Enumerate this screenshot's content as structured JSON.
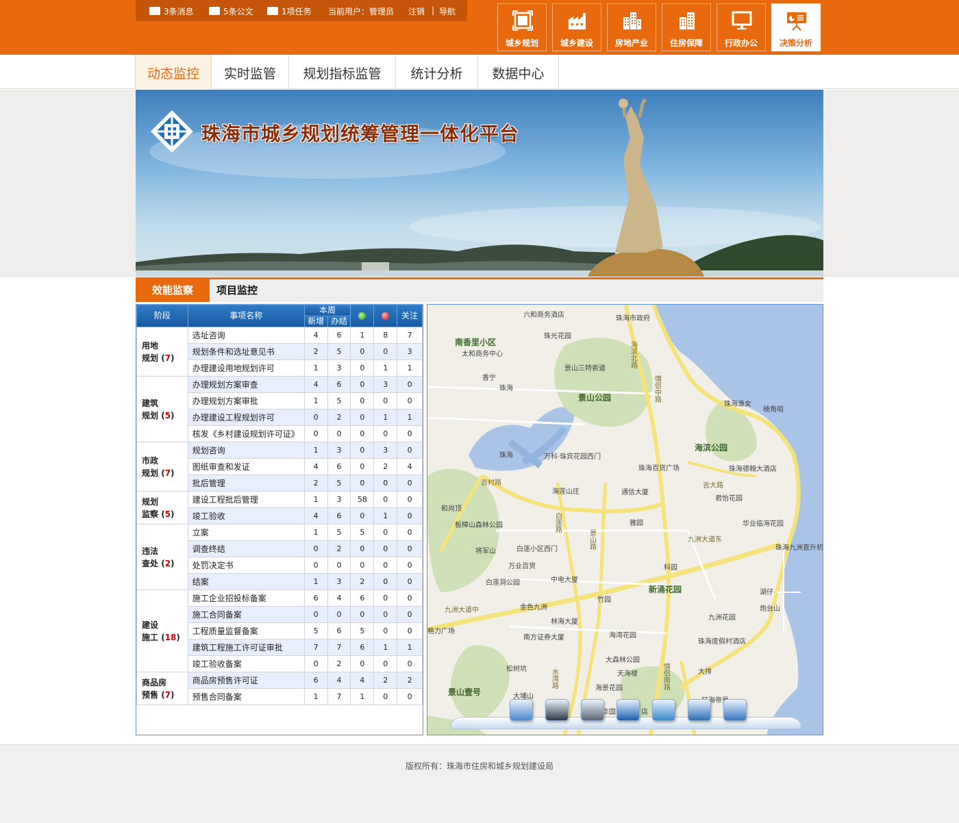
{
  "colors": {
    "brand": "#e8690e",
    "header_blue": "#1f6cb9",
    "alt_row": "#e8eefb"
  },
  "infobar": {
    "messages": "3条消息",
    "docs": "5条公文",
    "tasks": "1项任务",
    "current_user": "当前用户：管理员",
    "logout": "注销",
    "separator": "|",
    "nav": "导航"
  },
  "modules": [
    {
      "label": "城乡规划",
      "icon": "frame-icon"
    },
    {
      "label": "城乡建设",
      "icon": "factory-icon"
    },
    {
      "label": "房地产业",
      "icon": "buildings-icon"
    },
    {
      "label": "住房保障",
      "icon": "building-icon"
    },
    {
      "label": "行政办公",
      "icon": "monitor-icon"
    },
    {
      "label": "决策分析",
      "icon": "presentation-icon"
    }
  ],
  "nav_tabs": [
    {
      "label": "动态监控"
    },
    {
      "label": "实时监管"
    },
    {
      "label": "规划指标监管"
    },
    {
      "label": "统计分析"
    },
    {
      "label": "数据中心"
    }
  ],
  "banner": {
    "title": "珠海市城乡规划统筹管理一体化平台"
  },
  "sub_tabs": [
    {
      "label": "效能监察"
    },
    {
      "label": "项目监控"
    }
  ],
  "table": {
    "headers": {
      "stage": "阶段",
      "item": "事项名称",
      "week": "本周",
      "new": "新增",
      "done": "办结",
      "focus": "关注"
    },
    "groups": [
      {
        "name1": "用地",
        "name2": "规划",
        "count": "7",
        "rows": [
          [
            "选址咨询",
            "4",
            "6",
            "1",
            "8",
            "7"
          ],
          [
            "规划条件和选址意见书",
            "2",
            "5",
            "0",
            "0",
            "3"
          ],
          [
            "办理建设用地规划许可",
            "1",
            "3",
            "0",
            "1",
            "1"
          ]
        ]
      },
      {
        "name1": "建筑",
        "name2": "规划",
        "count": "5",
        "rows": [
          [
            "办理规划方案审查",
            "4",
            "6",
            "0",
            "3",
            "0"
          ],
          [
            "办理规划方案审批",
            "1",
            "5",
            "0",
            "0",
            "0"
          ],
          [
            "办理建设工程规划许可",
            "0",
            "2",
            "0",
            "1",
            "1"
          ],
          [
            "核发《乡村建设规划许可证》",
            "0",
            "0",
            "0",
            "0",
            "0"
          ]
        ]
      },
      {
        "name1": "市政",
        "name2": "规划",
        "count": "7",
        "rows": [
          [
            "规划咨询",
            "1",
            "3",
            "0",
            "3",
            "0"
          ],
          [
            "图纸审查和发证",
            "4",
            "6",
            "0",
            "2",
            "4"
          ],
          [
            "批后管理",
            "2",
            "5",
            "0",
            "0",
            "0"
          ]
        ]
      },
      {
        "name1": "规划",
        "name2": "监察",
        "count": "5",
        "rows": [
          [
            "建设工程批后管理",
            "1",
            "3",
            "58",
            "0",
            "0"
          ],
          [
            "竣工验收",
            "4",
            "6",
            "0",
            "1",
            "0"
          ]
        ]
      },
      {
        "name1": "违法",
        "name2": "查处",
        "count": "2",
        "rows": [
          [
            "立案",
            "1",
            "5",
            "5",
            "0",
            "0"
          ],
          [
            "调查终结",
            "0",
            "2",
            "0",
            "0",
            "0"
          ],
          [
            "处罚决定书",
            "0",
            "0",
            "0",
            "0",
            "0"
          ],
          [
            "结案",
            "1",
            "3",
            "2",
            "0",
            "0"
          ]
        ]
      },
      {
        "name1": "建设",
        "name2": "施工",
        "count": "18",
        "rows": [
          [
            "施工企业招投标备案",
            "6",
            "4",
            "6",
            "0",
            "0"
          ],
          [
            "施工合同备案",
            "0",
            "0",
            "0",
            "0",
            "0"
          ],
          [
            "工程质量监督备案",
            "5",
            "6",
            "5",
            "0",
            "0"
          ],
          [
            "建筑工程施工许可证审批",
            "7",
            "7",
            "6",
            "1",
            "1"
          ],
          [
            "竣工验收备案",
            "0",
            "2",
            "0",
            "0",
            "0"
          ]
        ]
      },
      {
        "name1": "商品房",
        "name2": "预售",
        "count": "7",
        "rows": [
          [
            "商品房预售许可证",
            "6",
            "4",
            "4",
            "2",
            "2"
          ],
          [
            "预售合同备案",
            "1",
            "7",
            "1",
            "0",
            "0"
          ]
        ]
      }
    ]
  },
  "map": {
    "labels": [
      {
        "t": "六和商务酒店"
      },
      {
        "t": "珠海市政府"
      },
      {
        "t": "南香里小区"
      },
      {
        "t": "珠光花园"
      },
      {
        "t": "太和商务中心"
      },
      {
        "t": "景山三特索道"
      },
      {
        "t": "香宁"
      },
      {
        "t": "珠海"
      },
      {
        "t": "景山公园"
      },
      {
        "t": "珠海渔女"
      },
      {
        "t": "棱角咀"
      },
      {
        "t": "海滨公园"
      },
      {
        "t": "珠海"
      },
      {
        "t": "万科·珠宾花园西门"
      },
      {
        "t": "珠海百货广场"
      },
      {
        "t": "珠海德翰大酒店"
      },
      {
        "t": "吉大路"
      },
      {
        "t": "吉村路"
      },
      {
        "t": "海莲山庄"
      },
      {
        "t": "通信大厦"
      },
      {
        "t": "君怡花园"
      },
      {
        "t": "和尚顶"
      },
      {
        "t": "板樟山森林公园"
      },
      {
        "t": "白莲路"
      },
      {
        "t": "景山路"
      },
      {
        "t": "雅园"
      },
      {
        "t": "华业临海花园"
      },
      {
        "t": "将军山"
      },
      {
        "t": "白莲小区西门"
      },
      {
        "t": "九洲大道东"
      },
      {
        "t": "珠海九洲直升机场"
      },
      {
        "t": "万业百货"
      },
      {
        "t": "科园"
      },
      {
        "t": "白莲洞公园"
      },
      {
        "t": "中电大厦"
      },
      {
        "t": "新涌花园"
      },
      {
        "t": "竹园"
      },
      {
        "t": "湖仔"
      },
      {
        "t": "九洲大道中"
      },
      {
        "t": "金色九洲"
      },
      {
        "t": "炮台山"
      },
      {
        "t": "九洲花园"
      },
      {
        "t": "林海大厦"
      },
      {
        "t": "格力广场"
      },
      {
        "t": "南方证券大厦"
      },
      {
        "t": "海湾花园"
      },
      {
        "t": "珠海度假村酒店"
      },
      {
        "t": "大森林公园"
      },
      {
        "t": "松树坑"
      },
      {
        "t": "天海楼"
      },
      {
        "t": "水湾路"
      },
      {
        "t": "情侣南路"
      },
      {
        "t": "大排"
      },
      {
        "t": "景山壹号"
      },
      {
        "t": "海景花园"
      },
      {
        "t": "大埔山"
      },
      {
        "t": "钰海帝景"
      },
      {
        "t": "华国"
      },
      {
        "t": "店"
      },
      {
        "t": "情侣中路"
      },
      {
        "t": "海滨北路"
      }
    ],
    "tools": [
      {
        "icon": "layers-icon"
      },
      {
        "icon": "binoculars-icon"
      },
      {
        "icon": "printer-icon"
      },
      {
        "icon": "save-icon"
      },
      {
        "icon": "fullscreen-icon"
      },
      {
        "icon": "measure-icon"
      },
      {
        "icon": "chart-icon"
      }
    ]
  },
  "footer": {
    "copyright": "版权所有：珠海市住房和城乡规划建设局"
  }
}
